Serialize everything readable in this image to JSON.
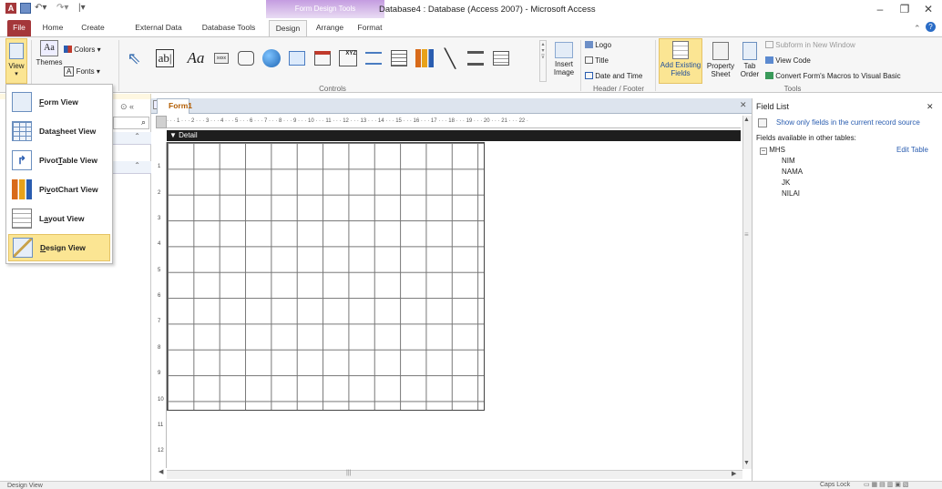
{
  "window": {
    "title": "Database4 : Database (Access 2007) - Microsoft Access",
    "context_tab": "Form Design Tools",
    "minimize": "–",
    "restore": "❐",
    "close": "✕"
  },
  "ribbon_tabs": [
    "File",
    "Home",
    "Create",
    "External Data",
    "Database Tools",
    "Design",
    "Arrange",
    "Format"
  ],
  "ribbon": {
    "view_label": "View",
    "themes_label": "Themes",
    "colors_label": "Colors",
    "fonts_label": "Fonts",
    "controls_label": "Controls",
    "insert_image_label": "Insert Image",
    "logo_label": "Logo",
    "title_label": "Title",
    "date_time_label": "Date and Time",
    "header_footer_label": "Header / Footer",
    "add_existing_fields": "Add Existing Fields",
    "property_sheet": "Property Sheet",
    "tab_order": "Tab Order",
    "subform_new_window": "Subform in New Window",
    "view_code": "View Code",
    "convert_macros": "Convert Form's Macros to Visual Basic",
    "tools_label": "Tools",
    "textbox_glyph": "ab|",
    "label_glyph": "Aa",
    "button_glyph": "xxxx",
    "xyz_glyph": "XYZ"
  },
  "view_menu": {
    "items": [
      {
        "label": "Form View",
        "accel_index": 0
      },
      {
        "label": "Datasheet View",
        "accel_index": 4
      },
      {
        "label": "PivotTable View",
        "accel_index": 5
      },
      {
        "label": "PivotChart View",
        "accel_index": 2
      },
      {
        "label": "Layout View",
        "accel_index": 1
      },
      {
        "label": "Design View",
        "accel_index": 0
      }
    ],
    "selected": "Design View"
  },
  "document": {
    "tab_label": "Form1",
    "detail_label": "Detail",
    "close_glyph": "✕",
    "ruler_text": "· · · 1 · · · 2 · · · 3 · · · 4 · · · 5 · · · 6 · · · 7 · · · 8 · · · 9 · · · 10 · · · 11 · · · 12 · · · 13 · · · 14 · · · 15 · · · 16 · · · 17 · · · 18 · · · 19 · · · 20 · · · 21 · · · 22 ·",
    "v_ruler": [
      "1",
      "2",
      "3",
      "4",
      "5",
      "6",
      "7",
      "8",
      "9",
      "10",
      "11",
      "12"
    ]
  },
  "field_list": {
    "title": "Field List",
    "show_only": "Show only fields in the current record source",
    "other_tables": "Fields available in other tables:",
    "table_name": "MHS",
    "edit_table": "Edit Table",
    "fields": [
      "NIM",
      "NAMA",
      "JK",
      "NILAI"
    ]
  },
  "status": {
    "left": "Design View",
    "caps": "Caps Lock"
  },
  "colors": {
    "file_tab": "#a4373a",
    "context_tab": "#c49ce0",
    "menu_highlight": "#fbe593",
    "form_tab_text": "#b25c00"
  }
}
